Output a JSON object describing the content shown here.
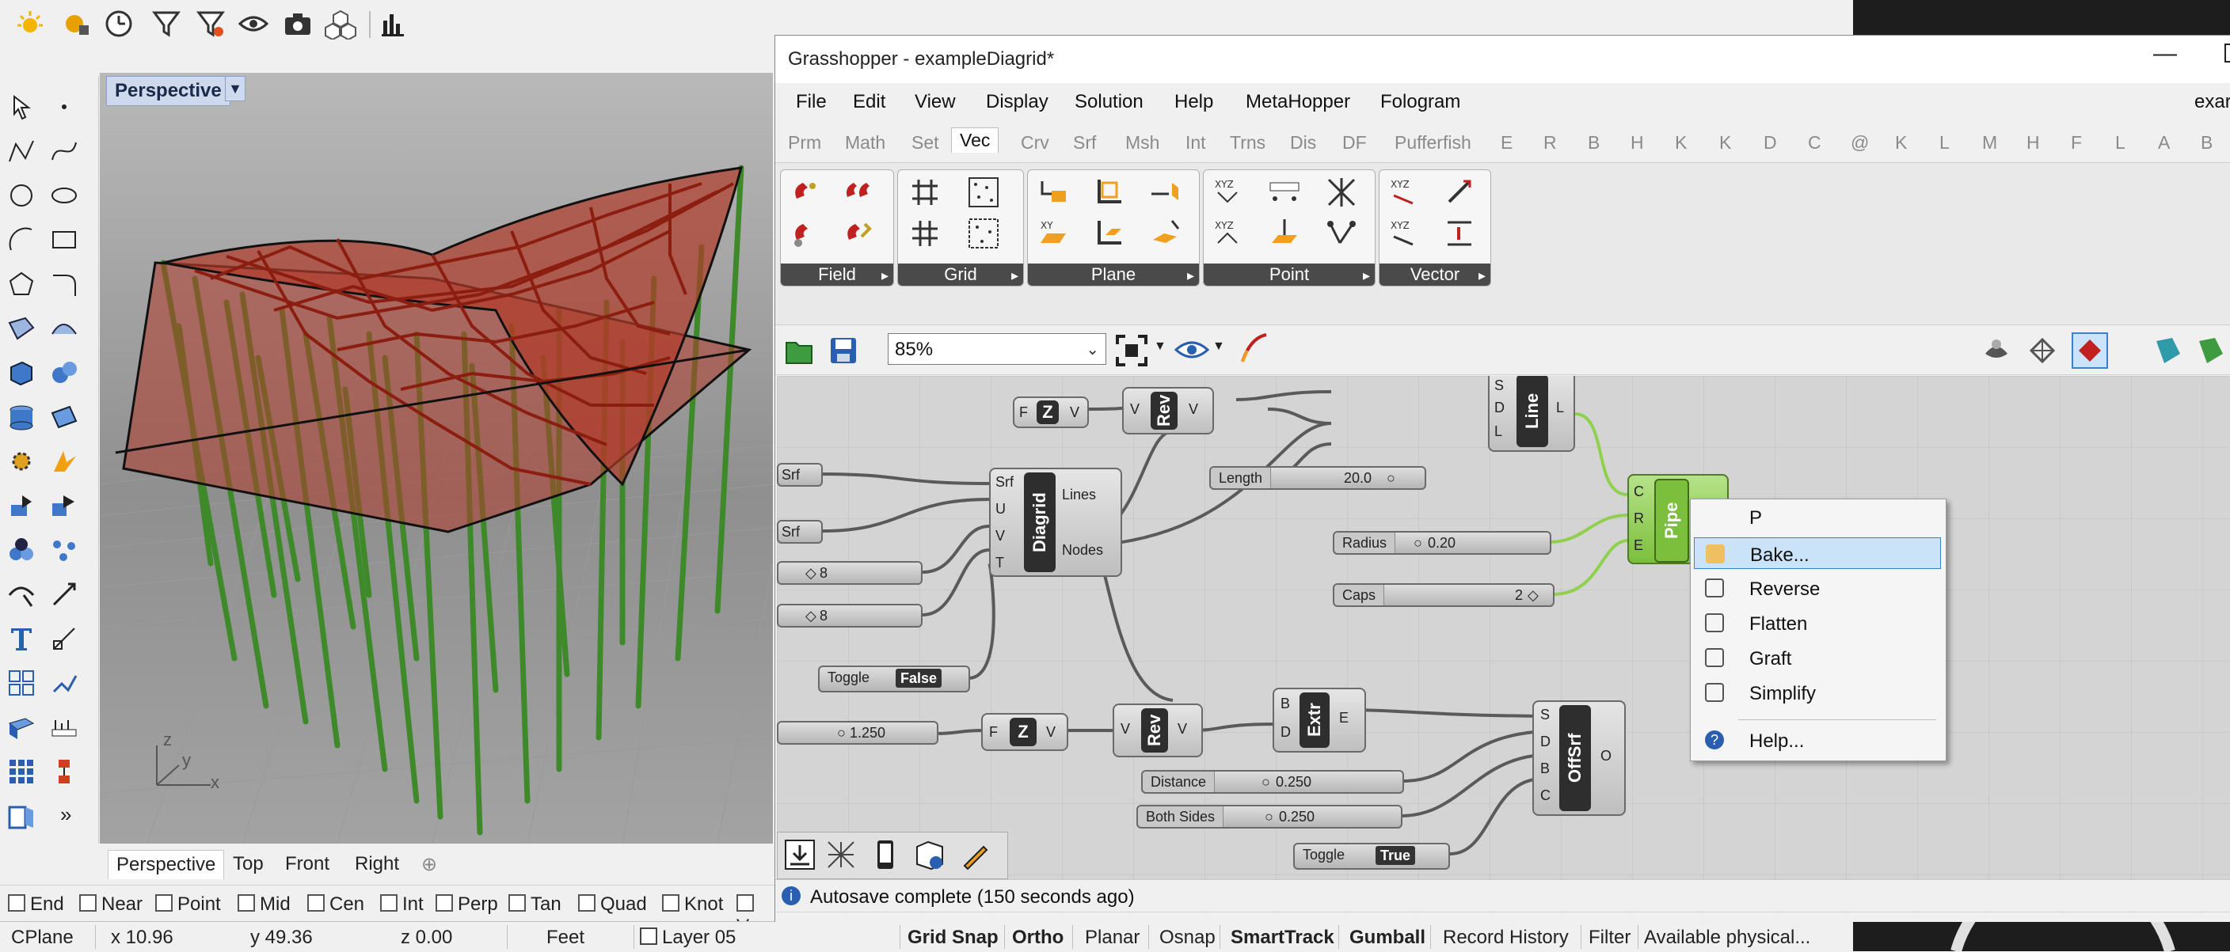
{
  "rhino": {
    "toolbar_icons": [
      "sun-icon",
      "render-settings-icon",
      "clock-icon",
      "filter-icon",
      "filter-2-icon",
      "eye-icon",
      "camera-icon",
      "cubes-icon",
      "bar-chart-icon"
    ],
    "viewport": {
      "name": "Perspective",
      "axes": {
        "x": "x",
        "y": "y",
        "z": "z"
      }
    },
    "view_tabs": [
      "Perspective",
      "Top",
      "Front",
      "Right"
    ],
    "view_tabs_add": "⊕",
    "osnaps": [
      "End",
      "Near",
      "Point",
      "Mid",
      "Cen",
      "Int",
      "Perp",
      "Tan",
      "Quad",
      "Knot",
      "Ve"
    ],
    "status": {
      "cplane": "CPlane",
      "x": "x 10.96",
      "y": "y 49.36",
      "z": "z 0.00",
      "units": "Feet",
      "layer": "Layer 05",
      "toggles": [
        "Grid Snap",
        "Ortho",
        "Planar",
        "Osnap",
        "SmartTrack",
        "Gumball",
        "Record History",
        "Filter",
        "Available physical..."
      ]
    }
  },
  "gh": {
    "title": "Grasshopper - exampleDiagrid*",
    "title_right": "exar",
    "menus": [
      "File",
      "Edit",
      "View",
      "Display",
      "Solution",
      "Help",
      "MetaHopper",
      "Fologram"
    ],
    "component_tabs": [
      "Prm",
      "Math",
      "Set",
      "Vec",
      "Crv",
      "Srf",
      "Msh",
      "Int",
      "Trns",
      "Dis",
      "DF",
      "Pufferfish",
      "E",
      "R",
      "B",
      "H",
      "K",
      "K",
      "D",
      "C",
      "@",
      "K",
      "L",
      "M",
      "H",
      "F",
      "L",
      "A",
      "B"
    ],
    "active_tab": "Vec",
    "panels": [
      {
        "name": "Field"
      },
      {
        "name": "Grid"
      },
      {
        "name": "Plane"
      },
      {
        "name": "Point"
      },
      {
        "name": "Vector"
      }
    ],
    "zoom": "85%",
    "canvas": {
      "diagrid": {
        "name": "Diagrid",
        "inputs": [
          "Srf",
          "U",
          "V",
          "T"
        ],
        "outputs": [
          "Lines",
          "Nodes"
        ]
      },
      "line": {
        "name": "Line",
        "inputs": [
          "S",
          "D",
          "L"
        ],
        "output": "L"
      },
      "pipe": {
        "name": "Pipe",
        "inputs": [
          "C",
          "R",
          "E"
        ],
        "output": "P"
      },
      "extr": {
        "name": "Extr",
        "inputs": [
          "B",
          "D"
        ],
        "output": "E"
      },
      "offsrf": {
        "name": "OffSrf",
        "inputs": [
          "S",
          "D",
          "B",
          "C"
        ],
        "output": "O"
      },
      "unitz_top": {
        "name": "Z",
        "in": "F",
        "out": "V"
      },
      "rev_top": {
        "name": "Rev",
        "in": "V",
        "out": "V"
      },
      "unitz_bot": {
        "name": "Z",
        "in": "F",
        "out": "V"
      },
      "rev_bot": {
        "name": "Rev",
        "in": "V",
        "out": "V"
      },
      "srf1": "Srf",
      "srf2": "Srf",
      "slider_u": "8",
      "slider_v": "8",
      "toggle1": {
        "label": "Toggle",
        "value": "False"
      },
      "slider_ext": "1.250",
      "length": {
        "label": "Length",
        "value": "20.0"
      },
      "radius": {
        "label": "Radius",
        "value": "0.20"
      },
      "caps": {
        "label": "Caps",
        "value": "2"
      },
      "distance": {
        "label": "Distance",
        "value": "0.250"
      },
      "both_sides": {
        "label": "Both Sides",
        "value": "0.250"
      },
      "toggle2": {
        "label": "Toggle",
        "value": "True"
      }
    },
    "autosave": "Autosave complete (150 seconds ago)"
  },
  "context_menu": {
    "header": "P",
    "items": [
      {
        "label": "Bake...",
        "icon": "bake-icon",
        "highlighted": true
      },
      {
        "label": "Reverse",
        "icon": "reverse-icon"
      },
      {
        "label": "Flatten",
        "icon": "flatten-icon"
      },
      {
        "label": "Graft",
        "icon": "graft-icon"
      },
      {
        "label": "Simplify",
        "icon": "simplify-icon"
      }
    ],
    "help": "Help..."
  },
  "colors": {
    "accent_blue": "#3d7fd3",
    "canvas": "#d4d4d4",
    "pipe_green": "#8fd14f",
    "model_red": "#b13a2a",
    "model_green": "#3e8a2a"
  }
}
